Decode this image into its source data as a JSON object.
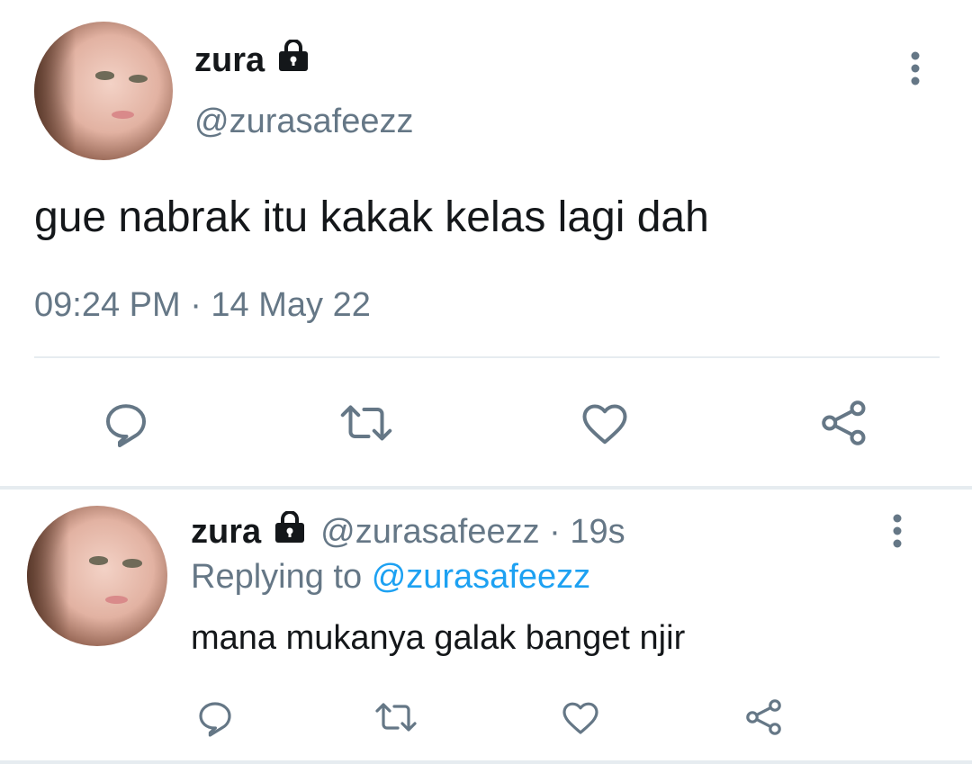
{
  "main_tweet": {
    "display_name": "zura",
    "handle": "@zurasafeezz",
    "text": "gue nabrak itu kakak kelas lagi dah",
    "timestamp": "09:24 PM · 14 May 22",
    "avatar_icon": "profile-photo",
    "lock_icon": "lock-icon",
    "more_icon": "more-vertical-icon"
  },
  "actions": {
    "reply_icon": "reply-icon",
    "retweet_icon": "retweet-icon",
    "like_icon": "heart-icon",
    "share_icon": "share-icon"
  },
  "reply_tweet": {
    "display_name": "zura",
    "handle_time": "@zurasafeezz · 19s",
    "replying_prefix": "Replying to",
    "replying_to": "@zurasafeezz",
    "text": "mana mukanya galak banget njir"
  },
  "colors": {
    "text": "#14171a",
    "secondary": "#657786",
    "link": "#1da1f2",
    "divider": "#e6ecf0"
  }
}
